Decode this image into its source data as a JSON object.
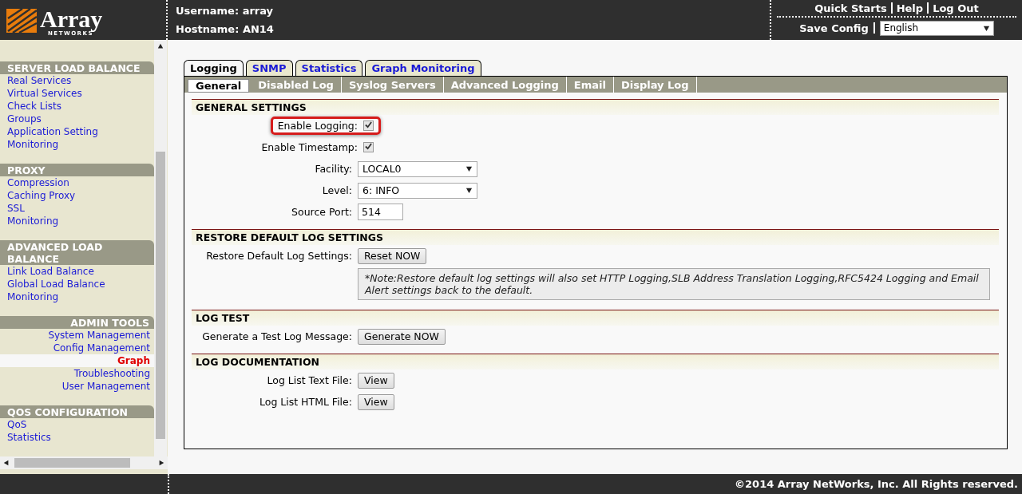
{
  "logo": {
    "name": "Array",
    "tagline": "NETWORKS"
  },
  "header": {
    "username": "Username: array",
    "hostname": "Hostname: AN14",
    "top_links": [
      "Quick Starts",
      "Help",
      "Log Out"
    ],
    "save_config": "Save Config",
    "language": "English"
  },
  "sidebar": {
    "sections": [
      {
        "title": "SERVER LOAD BALANCE",
        "kind": "standard",
        "items": [
          {
            "label": "Real Services",
            "selected": false
          },
          {
            "label": "Virtual Services",
            "selected": false
          },
          {
            "label": "Check Lists",
            "selected": false
          },
          {
            "label": "Groups",
            "selected": false
          },
          {
            "label": "Application Setting",
            "selected": false
          },
          {
            "label": "Monitoring",
            "selected": false
          }
        ]
      },
      {
        "title": "PROXY",
        "kind": "standard",
        "items": [
          {
            "label": "Compression",
            "selected": false
          },
          {
            "label": "Caching Proxy",
            "selected": false
          },
          {
            "label": "SSL",
            "selected": false
          },
          {
            "label": "Monitoring",
            "selected": false
          }
        ]
      },
      {
        "title": "ADVANCED LOAD BALANCE",
        "kind": "standard",
        "items": [
          {
            "label": "Link Load Balance",
            "selected": false
          },
          {
            "label": "Global Load Balance",
            "selected": false
          },
          {
            "label": "Monitoring",
            "selected": false
          }
        ]
      },
      {
        "title": "ADMIN TOOLS",
        "kind": "mirrored",
        "items": [
          {
            "label": "System Management",
            "selected": false
          },
          {
            "label": "Config Management",
            "selected": false
          },
          {
            "label": "Graph",
            "selected": true
          },
          {
            "label": "Troubleshooting",
            "selected": false
          },
          {
            "label": "User Management",
            "selected": false
          }
        ]
      },
      {
        "title": "QOS CONFIGURATION",
        "kind": "standard",
        "items": [
          {
            "label": "QoS",
            "selected": false
          },
          {
            "label": "Statistics",
            "selected": false
          }
        ]
      }
    ]
  },
  "tabs": [
    {
      "label": "Logging",
      "selected": true
    },
    {
      "label": "SNMP",
      "selected": false
    },
    {
      "label": "Statistics",
      "selected": false
    },
    {
      "label": "Graph Monitoring",
      "selected": false
    }
  ],
  "subtabs": [
    {
      "label": "General",
      "selected": true
    },
    {
      "label": "Disabled Log",
      "selected": false
    },
    {
      "label": "Syslog Servers",
      "selected": false
    },
    {
      "label": "Advanced Logging",
      "selected": false
    },
    {
      "label": "Email",
      "selected": false
    },
    {
      "label": "Display Log",
      "selected": false
    }
  ],
  "sections": [
    {
      "title": "GENERAL SETTINGS",
      "rows": [
        {
          "kind": "checkbox",
          "label": "Enable Logging:",
          "checked": true,
          "highlighted": true
        },
        {
          "kind": "checkbox",
          "label": "Enable Timestamp:",
          "checked": true,
          "highlighted": false
        },
        {
          "kind": "select",
          "label": "Facility:",
          "value": "LOCAL0"
        },
        {
          "kind": "select",
          "label": "Level:",
          "value": "6: INFO"
        },
        {
          "kind": "input",
          "label": "Source Port:",
          "value": "514"
        }
      ]
    },
    {
      "title": "RESTORE DEFAULT LOG SETTINGS",
      "rows": [
        {
          "kind": "button",
          "label": "Restore Default Log Settings:",
          "button": "Reset NOW"
        },
        {
          "kind": "note",
          "text": "*Note:Restore default log settings will also set HTTP Logging,SLB Address Translation Logging,RFC5424 Logging and Email Alert settings back to the default."
        }
      ]
    },
    {
      "title": "LOG TEST",
      "rows": [
        {
          "kind": "button",
          "label": "Generate a Test Log Message:",
          "button": "Generate NOW"
        }
      ]
    },
    {
      "title": "LOG DOCUMENTATION",
      "rows": [
        {
          "kind": "button",
          "label": "Log List Text File:",
          "button": "View"
        },
        {
          "kind": "button",
          "label": "Log List HTML File:",
          "button": "View"
        }
      ]
    }
  ],
  "footer": "©2014 Array NetWorks, Inc. All Rights reserved."
}
